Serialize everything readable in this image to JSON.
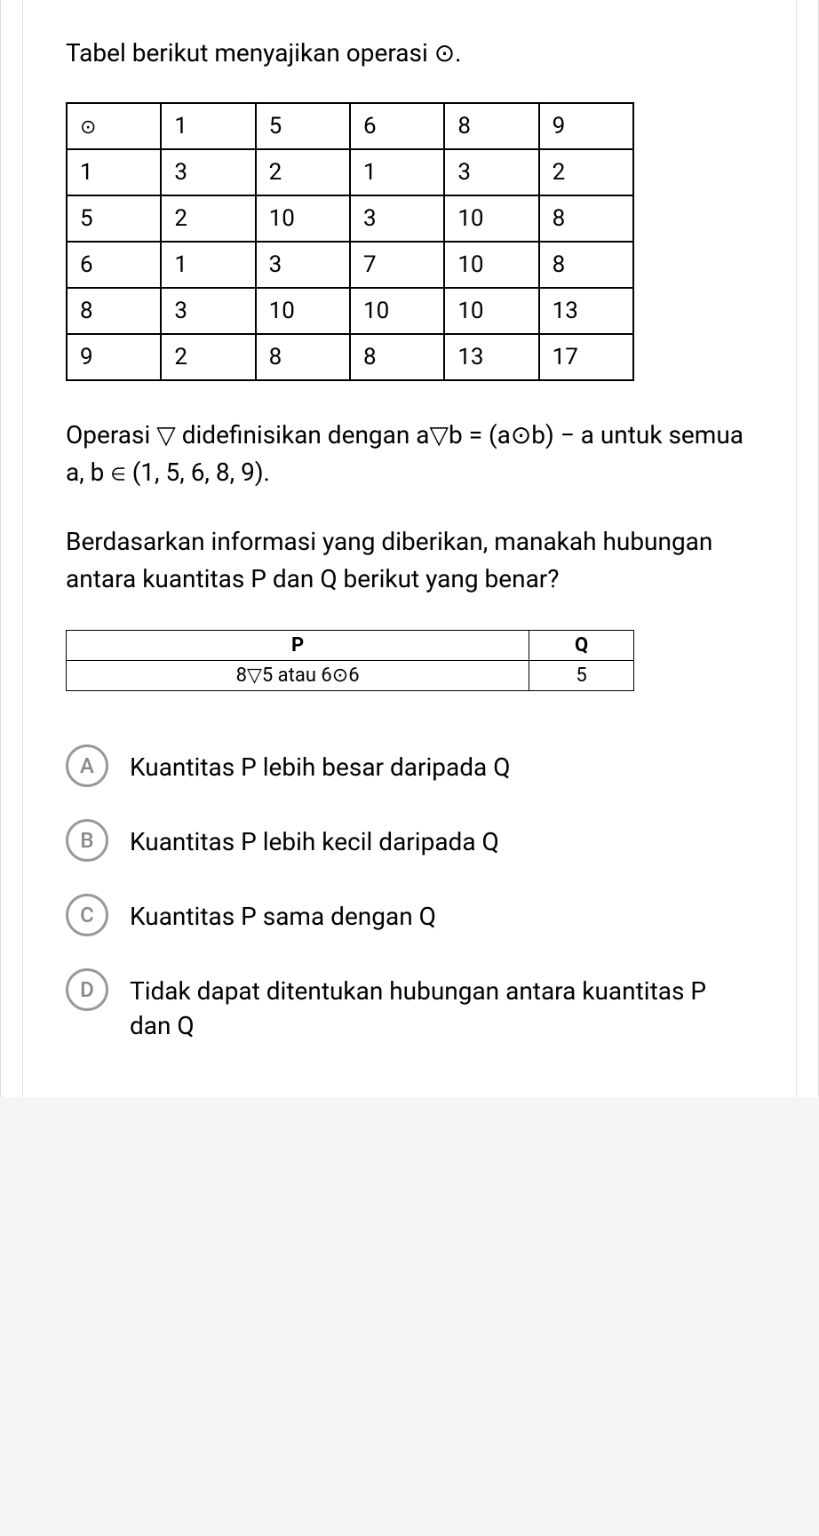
{
  "intro": "Tabel berikut menyajikan operasi ⊙.",
  "op_symbol": "⊙",
  "table": {
    "headers": [
      "⊙",
      "1",
      "5",
      "6",
      "8",
      "9"
    ],
    "rows": [
      [
        "1",
        "3",
        "2",
        "1",
        "3",
        "2"
      ],
      [
        "5",
        "2",
        "10",
        "3",
        "10",
        "8"
      ],
      [
        "6",
        "1",
        "3",
        "7",
        "10",
        "8"
      ],
      [
        "8",
        "3",
        "10",
        "10",
        "10",
        "13"
      ],
      [
        "9",
        "2",
        "8",
        "8",
        "13",
        "17"
      ]
    ]
  },
  "definition": {
    "part1": "Operasi ▽ didefinisikan dengan a▽b = (a⊙b) − a untuk semua a, b ",
    "elem": "∈",
    "part2": " (1, 5, 6, 8, 9)."
  },
  "question": "Berdasarkan informasi yang diberikan, manakah hubungan antara kuantitas P dan Q berikut yang benar?",
  "pq": {
    "header_p": "P",
    "header_q": "Q",
    "value_p": "8▽5 atau 6⊙6",
    "value_q": "5"
  },
  "options": [
    {
      "letter": "A",
      "text": "Kuantitas P lebih besar daripada Q"
    },
    {
      "letter": "B",
      "text": "Kuantitas P lebih kecil daripada Q"
    },
    {
      "letter": "C",
      "text": "Kuantitas P sama dengan Q"
    },
    {
      "letter": "D",
      "text": "Tidak dapat ditentukan hubungan antara kuantitas P dan Q"
    }
  ]
}
